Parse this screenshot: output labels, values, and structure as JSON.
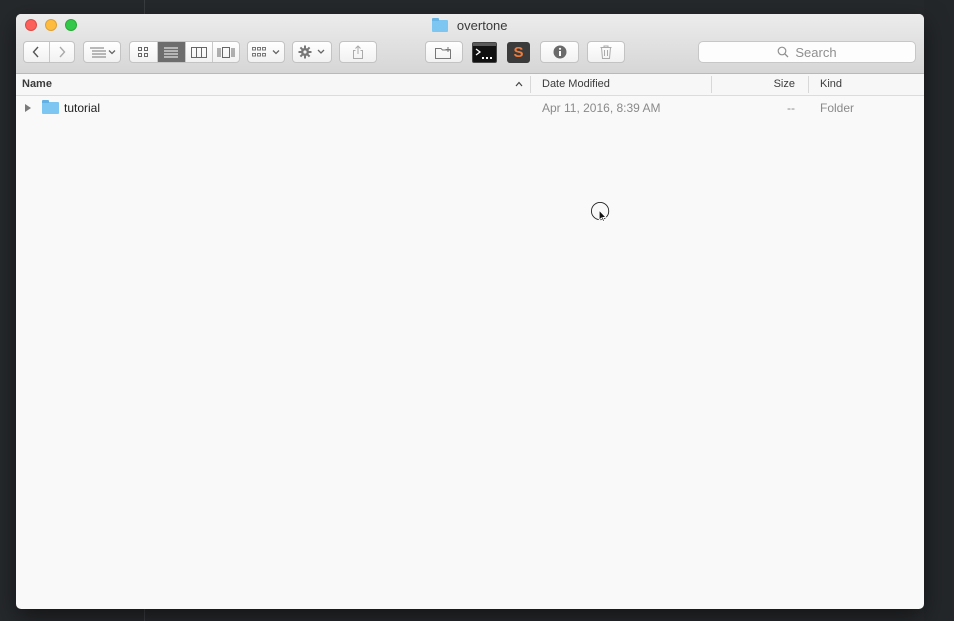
{
  "window": {
    "title": "overtone",
    "title_icon": "folder-icon"
  },
  "toolbar": {
    "back_icon": "chevron-left-icon",
    "forward_icon": "chevron-right-icon",
    "arrange_icon": "arrange-icon",
    "view_icons": [
      "icon-view-icon",
      "list-view-icon",
      "column-view-icon",
      "cover-flow-icon"
    ],
    "active_view": "list",
    "group_icon": "group-icon",
    "action_icon": "gear-icon",
    "share_icon": "share-icon",
    "new_folder_icon": "new-folder-icon",
    "terminal_icon": "terminal-icon",
    "sublime_icon": "sublime-text-icon",
    "sublime_glyph": "S",
    "info_icon": "info-icon",
    "trash_icon": "trash-icon"
  },
  "search": {
    "placeholder": "Search"
  },
  "columns": {
    "name": "Name",
    "date_modified": "Date Modified",
    "size": "Size",
    "kind": "Kind",
    "sort_indicator": "^"
  },
  "rows": [
    {
      "name": "tutorial",
      "date_modified": "Apr 11, 2016, 8:39 AM",
      "size": "--",
      "kind": "Folder",
      "icon": "folder-icon"
    }
  ],
  "colors": {
    "close": "#fc605b",
    "minimize": "#fdbc40",
    "maximize": "#34c84a",
    "folder": "#7ec6f2",
    "sublime_orange": "#ef7c3b"
  }
}
